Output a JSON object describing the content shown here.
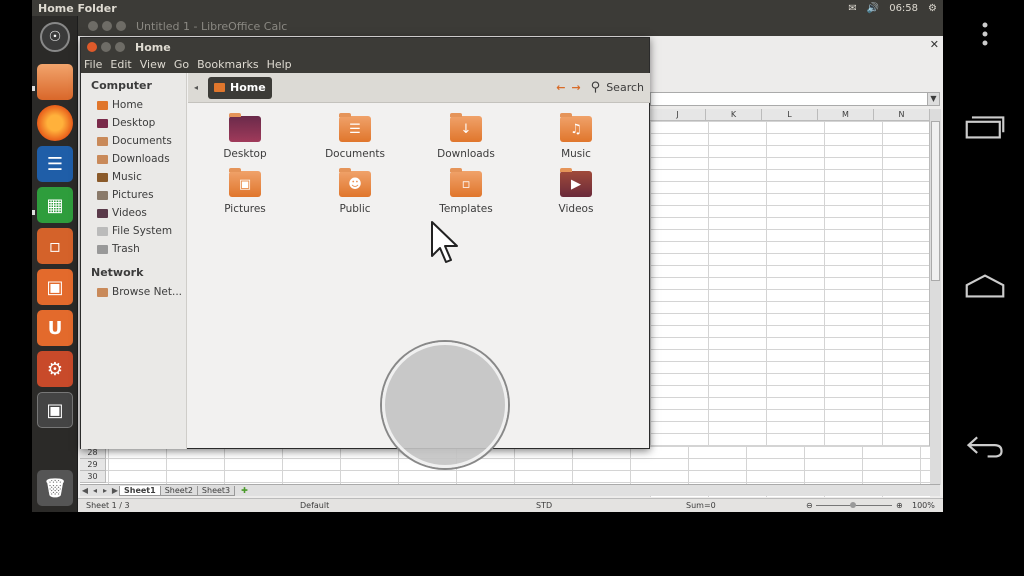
{
  "top_panel": {
    "title": "Home Folder",
    "time": "06:58",
    "mail_icon": "envelope-icon",
    "volume_icon": "speaker-icon",
    "gear_icon": "gear-icon"
  },
  "launcher": {
    "items": [
      {
        "name": "dash-home",
        "icon": "ubuntu-logo-icon",
        "color": "#3a3a3a"
      },
      {
        "name": "files",
        "icon": "folder-icon",
        "color": "#e0762c"
      },
      {
        "name": "firefox",
        "icon": "firefox-icon",
        "color": "#e85d1a"
      },
      {
        "name": "writer",
        "icon": "writer-icon",
        "color": "#1f5ea8"
      },
      {
        "name": "calc",
        "icon": "calc-icon",
        "color": "#2e9d3c"
      },
      {
        "name": "impress",
        "icon": "impress-icon",
        "color": "#d4622a"
      },
      {
        "name": "software-center",
        "icon": "bag-icon",
        "color": "#e36a2c"
      },
      {
        "name": "ubuntu-one",
        "icon": "u-icon",
        "color": "#e36a2c",
        "label": "U"
      },
      {
        "name": "settings",
        "icon": "settings-icon",
        "color": "#c84a2a"
      },
      {
        "name": "workspace-switcher",
        "icon": "workspace-icon",
        "color": "#444444"
      },
      {
        "name": "trash",
        "icon": "trash-icon",
        "color": "#555555"
      }
    ]
  },
  "calc": {
    "title": "Untitled 1 - LibreOffice Calc",
    "columns": [
      "J",
      "K",
      "L",
      "M",
      "N"
    ],
    "rows": [
      "28",
      "29",
      "30"
    ],
    "sheets": [
      "Sheet1",
      "Sheet2",
      "Sheet3"
    ],
    "active_sheet": "Sheet1",
    "status": {
      "sheet": "Sheet 1 / 3",
      "style": "Default",
      "mode": "STD",
      "sum": "Sum=0",
      "zoom": "100%"
    }
  },
  "nautilus": {
    "title": "Home",
    "menu": [
      "File",
      "Edit",
      "View",
      "Go",
      "Bookmarks",
      "Help"
    ],
    "path_button": "Home",
    "search_label": "Search",
    "sidebar": {
      "computer_header": "Computer",
      "computer_items": [
        {
          "label": "Home",
          "icon": "home-folder-icon"
        },
        {
          "label": "Desktop",
          "icon": "desktop-icon"
        },
        {
          "label": "Documents",
          "icon": "documents-icon"
        },
        {
          "label": "Downloads",
          "icon": "downloads-icon"
        },
        {
          "label": "Music",
          "icon": "music-icon"
        },
        {
          "label": "Pictures",
          "icon": "pictures-icon"
        },
        {
          "label": "Videos",
          "icon": "videos-icon"
        },
        {
          "label": "File System",
          "icon": "drive-icon"
        },
        {
          "label": "Trash",
          "icon": "trash-icon"
        }
      ],
      "network_header": "Network",
      "network_items": [
        {
          "label": "Browse Net...",
          "icon": "network-icon"
        }
      ]
    },
    "files": [
      {
        "label": "Desktop",
        "icon": "desktop-folder-icon"
      },
      {
        "label": "Documents",
        "icon": "documents-folder-icon"
      },
      {
        "label": "Downloads",
        "icon": "downloads-folder-icon"
      },
      {
        "label": "Music",
        "icon": "music-folder-icon"
      },
      {
        "label": "Pictures",
        "icon": "pictures-folder-icon"
      },
      {
        "label": "Public",
        "icon": "public-folder-icon"
      },
      {
        "label": "Templates",
        "icon": "templates-folder-icon"
      },
      {
        "label": "Videos",
        "icon": "videos-folder-icon"
      }
    ]
  },
  "android_nav": [
    "menu-icon",
    "recents-icon",
    "home-icon",
    "back-icon"
  ]
}
